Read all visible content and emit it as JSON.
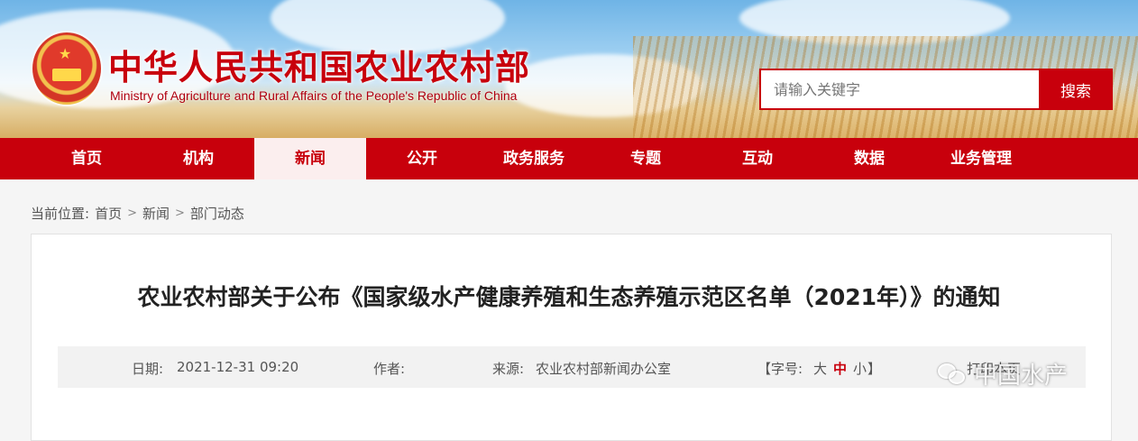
{
  "header": {
    "title_cn": "中华人民共和国农业农村部",
    "title_en": "Ministry of Agriculture and Rural Affairs of the People's Republic of China",
    "emblem_icon": "national-emblem-icon"
  },
  "search": {
    "placeholder": "请输入关键字",
    "button_label": "搜索"
  },
  "nav": {
    "items": [
      {
        "label": "首页"
      },
      {
        "label": "机构"
      },
      {
        "label": "新闻",
        "active": true
      },
      {
        "label": "公开"
      },
      {
        "label": "政务服务"
      },
      {
        "label": "专题"
      },
      {
        "label": "互动"
      },
      {
        "label": "数据"
      },
      {
        "label": "业务管理"
      }
    ]
  },
  "breadcrumb": {
    "prefix": "当前位置:",
    "items": [
      "首页",
      "新闻",
      "部门动态"
    ],
    "separator": ">"
  },
  "article": {
    "title": "农业农村部关于公布《国家级水产健康养殖和生态养殖示范区名单（2021年）》的通知",
    "date_label": "日期:",
    "date": "2021-12-31 09:20",
    "author_label": "作者:",
    "author": "",
    "source_label": "来源:",
    "source": "农业农村部新闻办公室",
    "font_size_label": "【字号:",
    "font_size_large": "大",
    "font_size_medium": "中",
    "font_size_small": "小",
    "font_size_close": "】",
    "print_label": "打印本页"
  },
  "watermark": {
    "text": "中国水产",
    "icon": "wechat-icon"
  },
  "colors": {
    "brand_red": "#c8000c",
    "nav_active_bg": "#fbeeee",
    "meta_bg": "#f2f2f2"
  }
}
